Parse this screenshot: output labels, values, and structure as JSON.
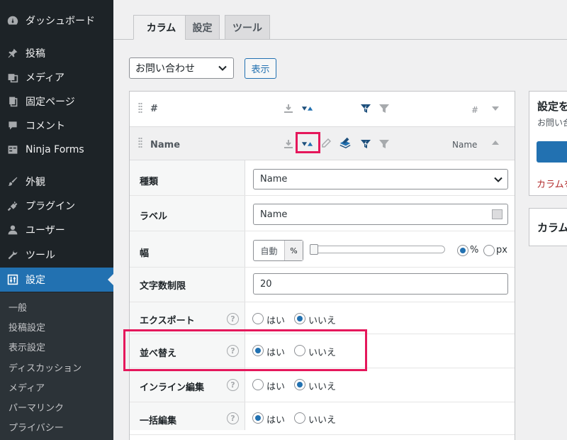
{
  "sidebar": {
    "top_items": [
      {
        "label": "ダッシュボード",
        "icon": "dashboard-icon"
      }
    ],
    "items": [
      {
        "label": "投稿",
        "icon": "pin-icon"
      },
      {
        "label": "メディア",
        "icon": "media-icon"
      },
      {
        "label": "固定ページ",
        "icon": "page-icon"
      },
      {
        "label": "コメント",
        "icon": "comment-icon"
      },
      {
        "label": "Ninja Forms",
        "icon": "forms-icon"
      }
    ],
    "items2": [
      {
        "label": "外観",
        "icon": "brush-icon"
      },
      {
        "label": "プラグイン",
        "icon": "plugin-icon"
      },
      {
        "label": "ユーザー",
        "icon": "user-icon"
      },
      {
        "label": "ツール",
        "icon": "wrench-icon"
      },
      {
        "label": "設定",
        "icon": "settings-icon"
      }
    ],
    "submenu": [
      "一般",
      "投稿設定",
      "表示設定",
      "ディスカッション",
      "メディア",
      "パーマリンク",
      "プライバシー"
    ]
  },
  "tabs": [
    {
      "label": "カラム",
      "active": true
    },
    {
      "label": "設定",
      "active": false
    },
    {
      "label": "ツール",
      "active": false
    }
  ],
  "toolbar": {
    "form_select_value": "お問い合わせ",
    "show_button": "表示"
  },
  "columns": {
    "hash": {
      "title": "#",
      "type_label": "#"
    },
    "name": {
      "title": "Name",
      "type_label": "Name"
    }
  },
  "settings": {
    "type": {
      "label": "種類",
      "value": "Name"
    },
    "label": {
      "label": "ラベル",
      "value": "Name"
    },
    "width": {
      "label": "幅",
      "auto": "自動",
      "unit_btn": "%",
      "opt_percent": "%",
      "opt_px": "px"
    },
    "charlimit": {
      "label": "文字数制限",
      "value": "20"
    },
    "export": {
      "label": "エクスポート",
      "yes": "はい",
      "no": "いいえ",
      "selected": "no"
    },
    "sort": {
      "label": "並べ替え",
      "yes": "はい",
      "no": "いいえ",
      "selected": "yes"
    },
    "inline_edit": {
      "label": "インライン編集",
      "yes": "はい",
      "no": "いいえ",
      "selected": "no"
    },
    "bulk_edit": {
      "label": "一括編集",
      "yes": "はい",
      "no": "いいえ",
      "selected": "yes"
    },
    "help": "?"
  },
  "side": {
    "box1_title": "設定を",
    "box1_sub": "お問い合",
    "box1_link": "カラムを",
    "box2_title": "カラム"
  },
  "colors": {
    "accent": "#2271b1",
    "highlight": "#e5175b",
    "sidebar_bg": "#1d2327"
  }
}
